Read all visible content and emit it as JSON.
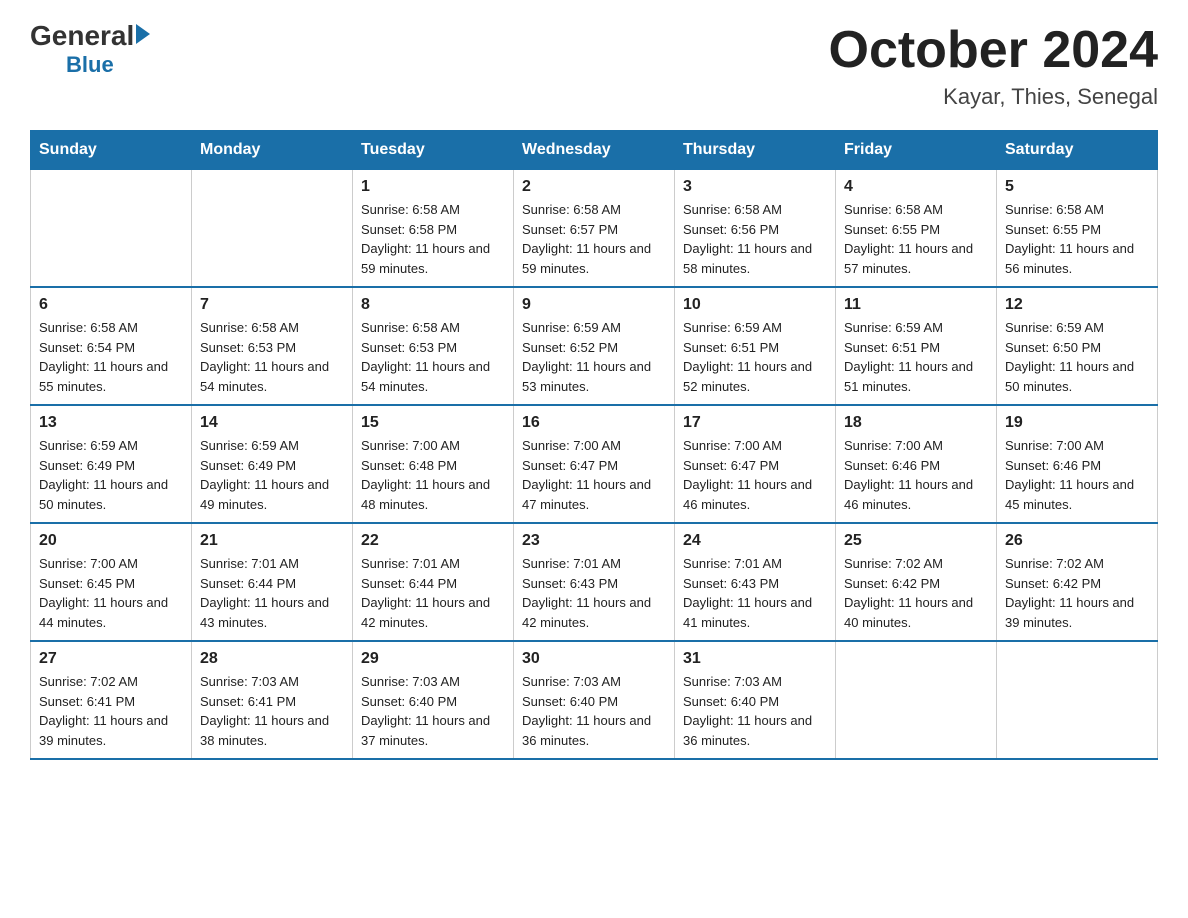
{
  "logo": {
    "general": "General",
    "blue": "Blue"
  },
  "title": "October 2024",
  "subtitle": "Kayar, Thies, Senegal",
  "headers": [
    "Sunday",
    "Monday",
    "Tuesday",
    "Wednesday",
    "Thursday",
    "Friday",
    "Saturday"
  ],
  "weeks": [
    [
      {
        "day": "",
        "sunrise": "",
        "sunset": "",
        "daylight": ""
      },
      {
        "day": "",
        "sunrise": "",
        "sunset": "",
        "daylight": ""
      },
      {
        "day": "1",
        "sunrise": "Sunrise: 6:58 AM",
        "sunset": "Sunset: 6:58 PM",
        "daylight": "Daylight: 11 hours and 59 minutes."
      },
      {
        "day": "2",
        "sunrise": "Sunrise: 6:58 AM",
        "sunset": "Sunset: 6:57 PM",
        "daylight": "Daylight: 11 hours and 59 minutes."
      },
      {
        "day": "3",
        "sunrise": "Sunrise: 6:58 AM",
        "sunset": "Sunset: 6:56 PM",
        "daylight": "Daylight: 11 hours and 58 minutes."
      },
      {
        "day": "4",
        "sunrise": "Sunrise: 6:58 AM",
        "sunset": "Sunset: 6:55 PM",
        "daylight": "Daylight: 11 hours and 57 minutes."
      },
      {
        "day": "5",
        "sunrise": "Sunrise: 6:58 AM",
        "sunset": "Sunset: 6:55 PM",
        "daylight": "Daylight: 11 hours and 56 minutes."
      }
    ],
    [
      {
        "day": "6",
        "sunrise": "Sunrise: 6:58 AM",
        "sunset": "Sunset: 6:54 PM",
        "daylight": "Daylight: 11 hours and 55 minutes."
      },
      {
        "day": "7",
        "sunrise": "Sunrise: 6:58 AM",
        "sunset": "Sunset: 6:53 PM",
        "daylight": "Daylight: 11 hours and 54 minutes."
      },
      {
        "day": "8",
        "sunrise": "Sunrise: 6:58 AM",
        "sunset": "Sunset: 6:53 PM",
        "daylight": "Daylight: 11 hours and 54 minutes."
      },
      {
        "day": "9",
        "sunrise": "Sunrise: 6:59 AM",
        "sunset": "Sunset: 6:52 PM",
        "daylight": "Daylight: 11 hours and 53 minutes."
      },
      {
        "day": "10",
        "sunrise": "Sunrise: 6:59 AM",
        "sunset": "Sunset: 6:51 PM",
        "daylight": "Daylight: 11 hours and 52 minutes."
      },
      {
        "day": "11",
        "sunrise": "Sunrise: 6:59 AM",
        "sunset": "Sunset: 6:51 PM",
        "daylight": "Daylight: 11 hours and 51 minutes."
      },
      {
        "day": "12",
        "sunrise": "Sunrise: 6:59 AM",
        "sunset": "Sunset: 6:50 PM",
        "daylight": "Daylight: 11 hours and 50 minutes."
      }
    ],
    [
      {
        "day": "13",
        "sunrise": "Sunrise: 6:59 AM",
        "sunset": "Sunset: 6:49 PM",
        "daylight": "Daylight: 11 hours and 50 minutes."
      },
      {
        "day": "14",
        "sunrise": "Sunrise: 6:59 AM",
        "sunset": "Sunset: 6:49 PM",
        "daylight": "Daylight: 11 hours and 49 minutes."
      },
      {
        "day": "15",
        "sunrise": "Sunrise: 7:00 AM",
        "sunset": "Sunset: 6:48 PM",
        "daylight": "Daylight: 11 hours and 48 minutes."
      },
      {
        "day": "16",
        "sunrise": "Sunrise: 7:00 AM",
        "sunset": "Sunset: 6:47 PM",
        "daylight": "Daylight: 11 hours and 47 minutes."
      },
      {
        "day": "17",
        "sunrise": "Sunrise: 7:00 AM",
        "sunset": "Sunset: 6:47 PM",
        "daylight": "Daylight: 11 hours and 46 minutes."
      },
      {
        "day": "18",
        "sunrise": "Sunrise: 7:00 AM",
        "sunset": "Sunset: 6:46 PM",
        "daylight": "Daylight: 11 hours and 46 minutes."
      },
      {
        "day": "19",
        "sunrise": "Sunrise: 7:00 AM",
        "sunset": "Sunset: 6:46 PM",
        "daylight": "Daylight: 11 hours and 45 minutes."
      }
    ],
    [
      {
        "day": "20",
        "sunrise": "Sunrise: 7:00 AM",
        "sunset": "Sunset: 6:45 PM",
        "daylight": "Daylight: 11 hours and 44 minutes."
      },
      {
        "day": "21",
        "sunrise": "Sunrise: 7:01 AM",
        "sunset": "Sunset: 6:44 PM",
        "daylight": "Daylight: 11 hours and 43 minutes."
      },
      {
        "day": "22",
        "sunrise": "Sunrise: 7:01 AM",
        "sunset": "Sunset: 6:44 PM",
        "daylight": "Daylight: 11 hours and 42 minutes."
      },
      {
        "day": "23",
        "sunrise": "Sunrise: 7:01 AM",
        "sunset": "Sunset: 6:43 PM",
        "daylight": "Daylight: 11 hours and 42 minutes."
      },
      {
        "day": "24",
        "sunrise": "Sunrise: 7:01 AM",
        "sunset": "Sunset: 6:43 PM",
        "daylight": "Daylight: 11 hours and 41 minutes."
      },
      {
        "day": "25",
        "sunrise": "Sunrise: 7:02 AM",
        "sunset": "Sunset: 6:42 PM",
        "daylight": "Daylight: 11 hours and 40 minutes."
      },
      {
        "day": "26",
        "sunrise": "Sunrise: 7:02 AM",
        "sunset": "Sunset: 6:42 PM",
        "daylight": "Daylight: 11 hours and 39 minutes."
      }
    ],
    [
      {
        "day": "27",
        "sunrise": "Sunrise: 7:02 AM",
        "sunset": "Sunset: 6:41 PM",
        "daylight": "Daylight: 11 hours and 39 minutes."
      },
      {
        "day": "28",
        "sunrise": "Sunrise: 7:03 AM",
        "sunset": "Sunset: 6:41 PM",
        "daylight": "Daylight: 11 hours and 38 minutes."
      },
      {
        "day": "29",
        "sunrise": "Sunrise: 7:03 AM",
        "sunset": "Sunset: 6:40 PM",
        "daylight": "Daylight: 11 hours and 37 minutes."
      },
      {
        "day": "30",
        "sunrise": "Sunrise: 7:03 AM",
        "sunset": "Sunset: 6:40 PM",
        "daylight": "Daylight: 11 hours and 36 minutes."
      },
      {
        "day": "31",
        "sunrise": "Sunrise: 7:03 AM",
        "sunset": "Sunset: 6:40 PM",
        "daylight": "Daylight: 11 hours and 36 minutes."
      },
      {
        "day": "",
        "sunrise": "",
        "sunset": "",
        "daylight": ""
      },
      {
        "day": "",
        "sunrise": "",
        "sunset": "",
        "daylight": ""
      }
    ]
  ]
}
